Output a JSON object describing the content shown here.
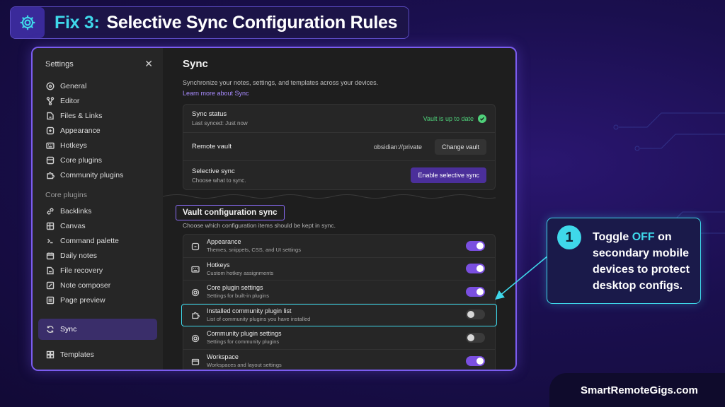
{
  "header": {
    "fix_label": "Fix 3:",
    "title": "Selective Sync Configuration Rules",
    "icon": "gear-icon"
  },
  "sidebar": {
    "title": "Settings",
    "options_items": [
      {
        "label": "General",
        "icon": "circle-check-icon"
      },
      {
        "label": "Editor",
        "icon": "branch-icon"
      },
      {
        "label": "Files & Links",
        "icon": "file-link-icon"
      },
      {
        "label": "Appearance",
        "icon": "palette-icon"
      },
      {
        "label": "Hotkeys",
        "icon": "keyboard-icon"
      },
      {
        "label": "Core plugins",
        "icon": "plug-icon"
      },
      {
        "label": "Community plugins",
        "icon": "puzzle-icon"
      }
    ],
    "core_section_label": "Core plugins",
    "core_items": [
      {
        "label": "Backlinks",
        "icon": "backlink-icon"
      },
      {
        "label": "Canvas",
        "icon": "canvas-icon"
      },
      {
        "label": "Command palette",
        "icon": "terminal-icon"
      },
      {
        "label": "Daily notes",
        "icon": "calendar-icon"
      },
      {
        "label": "File recovery",
        "icon": "file-recovery-icon"
      },
      {
        "label": "Note composer",
        "icon": "compose-icon"
      },
      {
        "label": "Page preview",
        "icon": "preview-icon"
      }
    ],
    "active_item": "Sync",
    "templates_item": "Templates"
  },
  "main": {
    "title": "Sync",
    "description": "Synchronize your notes, settings, and templates across your devices.",
    "learn_more": "Learn more about Sync",
    "sync_status": {
      "title": "Sync status",
      "subtitle": "Last synced: Just now",
      "status": "Vault is up to date"
    },
    "remote_vault": {
      "title": "Remote vault",
      "value": "obsidian://private",
      "button": "Change vault"
    },
    "selective_sync": {
      "title": "Selective sync",
      "subtitle": "Choose what to sync.",
      "button": "Enable selective sync"
    },
    "vault_config": {
      "title": "Vault configuration sync",
      "description": "Choose which configuration items should be kept in sync.",
      "items": [
        {
          "title": "Appearance",
          "subtitle": "Themes, snippets, CSS, and UI settings",
          "on": true
        },
        {
          "title": "Hotkeys",
          "subtitle": "Custom hotkey assignments",
          "on": true
        },
        {
          "title": "Core plugin settings",
          "subtitle": "Settings for built-in plugins",
          "on": true
        },
        {
          "title": "Installed community plugin list",
          "subtitle": "List of community plugins you have installed",
          "on": false
        },
        {
          "title": "Community plugin settings",
          "subtitle": "Settings for community plugins",
          "on": false
        },
        {
          "title": "Workspace",
          "subtitle": "Workspaces and layout settings",
          "on": true
        }
      ]
    }
  },
  "callout": {
    "number": "1",
    "text_before": "Toggle",
    "text_highlight": "OFF",
    "text_after": "on secondary mobile devices to protect desktop configs."
  },
  "footer": "SmartRemoteGigs.com",
  "colors": {
    "accent_cyan": "#3fd8ea",
    "accent_purple": "#7a4fe0",
    "success_green": "#4fd17a"
  }
}
